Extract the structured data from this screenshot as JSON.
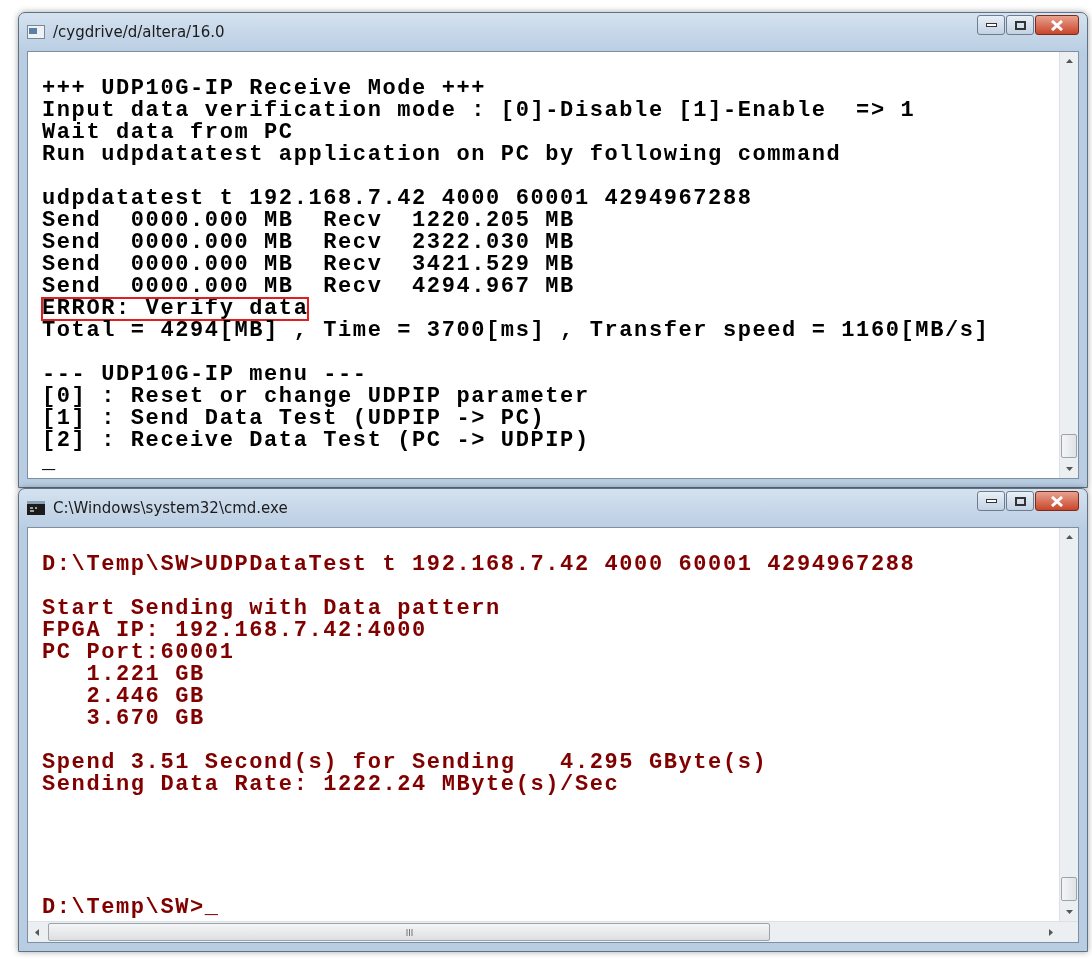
{
  "windows": [
    {
      "title": "/cygdrive/d/altera/16.0",
      "color": "#000000",
      "blocks": [
        {
          "kind": "output",
          "lines": [
            {
              "text": "+++ UDP10G-IP Receive Mode +++",
              "highlighted": false
            },
            {
              "text": "Input data verification mode : [0]-Disable [1]-Enable  => 1",
              "highlighted": false
            },
            {
              "text": "Wait data from PC",
              "highlighted": false
            },
            {
              "text": "Run udpdatatest application on PC by following command",
              "highlighted": false
            }
          ]
        },
        {
          "kind": "output",
          "lines": [
            {
              "text": "udpdatatest t 192.168.7.42 4000 60001 4294967288",
              "highlighted": false
            },
            {
              "text": "Send  0000.000 MB  Recv  1220.205 MB",
              "highlighted": false
            },
            {
              "text": "Send  0000.000 MB  Recv  2322.030 MB",
              "highlighted": false
            },
            {
              "text": "Send  0000.000 MB  Recv  3421.529 MB",
              "highlighted": false
            },
            {
              "text": "Send  0000.000 MB  Recv  4294.967 MB",
              "highlighted": false
            },
            {
              "text": "ERROR: Verify data",
              "highlighted": true
            },
            {
              "text": "Total = 4294[MB] , Time = 3700[ms] , Transfer speed = 1160[MB/s]",
              "highlighted": false
            }
          ]
        },
        {
          "kind": "output",
          "lines": [
            {
              "text": "--- UDP10G-IP menu ---",
              "highlighted": false
            },
            {
              "text": "[0] : Reset or change UDPIP parameter",
              "highlighted": false
            },
            {
              "text": "[1] : Send Data Test (UDPIP -> PC)",
              "highlighted": false
            },
            {
              "text": "[2] : Receive Data Test (PC -> UDPIP)",
              "highlighted": false
            },
            {
              "text": "_",
              "highlighted": false
            }
          ]
        }
      ]
    },
    {
      "title": "C:\\Windows\\system32\\cmd.exe",
      "color": "#800000",
      "blocks": [
        {
          "kind": "output",
          "lines": [
            {
              "text": "D:\\Temp\\SW>UDPDataTest t 192.168.7.42 4000 60001 4294967288",
              "highlighted": false
            }
          ]
        },
        {
          "kind": "output",
          "lines": [
            {
              "text": "Start Sending with Data pattern",
              "highlighted": false
            },
            {
              "text": "FPGA IP: 192.168.7.42:4000",
              "highlighted": false
            },
            {
              "text": "PC Port:60001",
              "highlighted": false
            },
            {
              "text": "   1.221 GB",
              "highlighted": false
            },
            {
              "text": "   2.446 GB",
              "highlighted": false
            },
            {
              "text": "   3.670 GB",
              "highlighted": false
            }
          ]
        },
        {
          "kind": "output",
          "lines": [
            {
              "text": "Spend 3.51 Second(s) for Sending   4.295 GByte(s)",
              "highlighted": false
            },
            {
              "text": "Sending Data Rate: 1222.24 MByte(s)/Sec",
              "highlighted": false
            }
          ]
        },
        {
          "kind": "prompt",
          "lines": [
            {
              "text": "D:\\Temp\\SW>_",
              "highlighted": false
            }
          ]
        }
      ]
    }
  ]
}
